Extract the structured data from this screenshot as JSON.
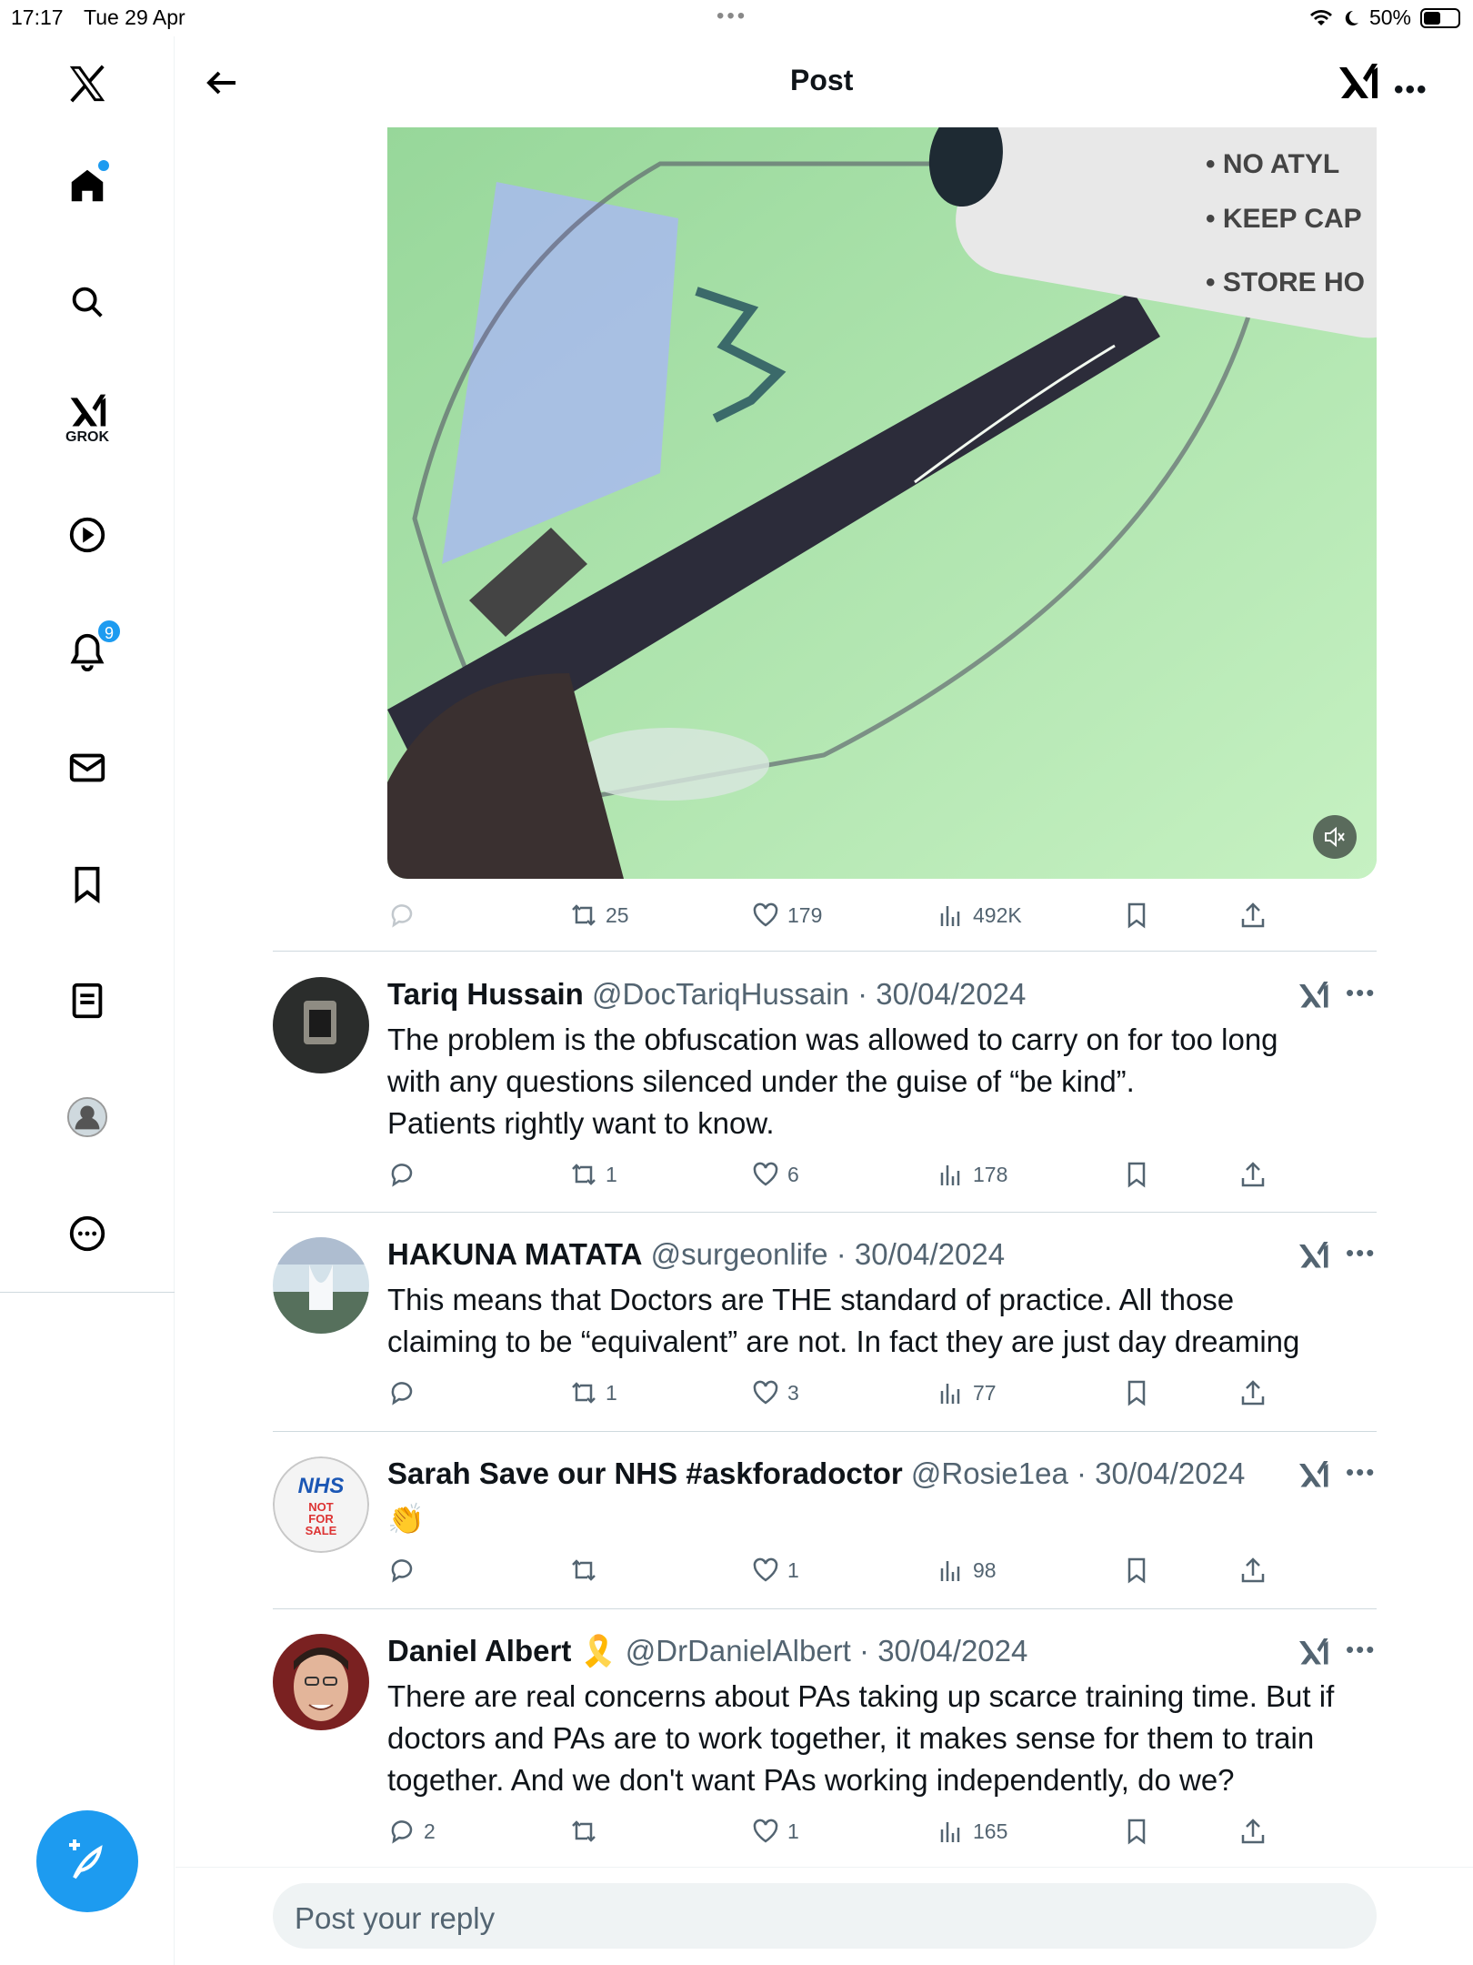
{
  "status": {
    "time": "17:17",
    "date": "Tue 29 Apr",
    "battery": "50%"
  },
  "header": {
    "title": "Post"
  },
  "sidebar": {
    "grok_label": "GROK",
    "notifications_count": "9"
  },
  "main_post": {
    "retweets": "25",
    "likes": "179",
    "views": "492K"
  },
  "replies": [
    {
      "name": "Tariq Hussain",
      "handle": "@DocTariqHussain",
      "date": "· 30/04/2024",
      "lines": [
        "The problem is the obfuscation was allowed to carry on for too long",
        "with any questions silenced under the guise of “be kind”.",
        "Patients rightly want to know."
      ],
      "replies": "",
      "retweets": "1",
      "likes": "6",
      "views": "178"
    },
    {
      "name": "HAKUNA MATATA",
      "handle": "@surgeonlife",
      "date": "· 30/04/2024",
      "lines": [
        "This means that Doctors are THE standard of practice. All those",
        "claiming to be “equivalent” are not. In fact they are just day dreaming"
      ],
      "replies": "",
      "retweets": "1",
      "likes": "3",
      "views": "77"
    },
    {
      "name": "Sarah Save our NHS #askforadoctor",
      "handle": "@Rosie1ea",
      "date": "· 30/04/2024",
      "lines": [
        "👏"
      ],
      "replies": "",
      "retweets": "",
      "likes": "1",
      "views": "98"
    },
    {
      "name": "Daniel Albert",
      "name_emoji": "🎗️",
      "handle": "@DrDanielAlbert",
      "date": "· 30/04/2024",
      "lines": [
        "There are real concerns about PAs taking up scarce training time. But if",
        "doctors and PAs are to work together, it makes sense for them to train",
        "together. And we don't want PAs working independently, do we?"
      ],
      "replies": "2",
      "retweets": "",
      "likes": "1",
      "views": "165"
    }
  ],
  "reply_box": {
    "placeholder": "Post your reply"
  },
  "media_text": {
    "line1": "• NO ATYL",
    "line2": "• KEEP CAP",
    "line3": "• STORE HO"
  },
  "avatar_text": {
    "nhs": "NHS",
    "not": "NOT",
    "for": "FOR",
    "sale": "SALE"
  }
}
